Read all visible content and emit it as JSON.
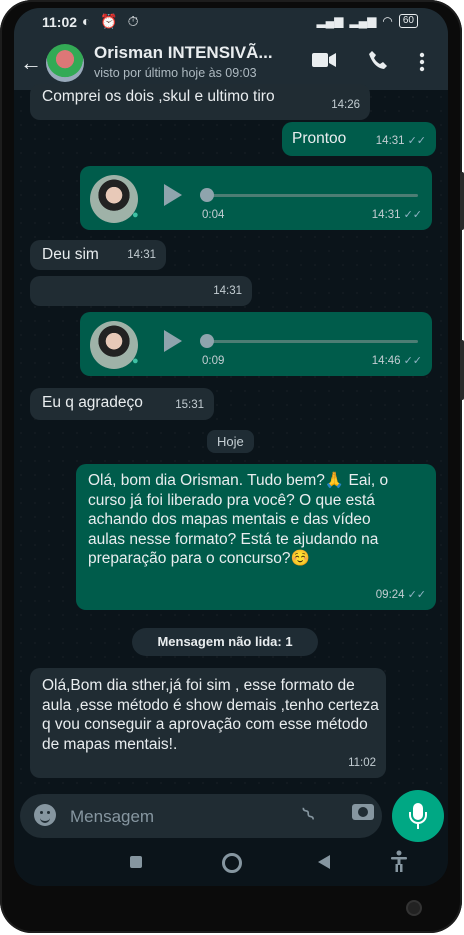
{
  "status_bar": {
    "time": "11:02",
    "left_icons": "◐ ⏰ ⏱",
    "signal": "▂▄▆",
    "wifi": "◠",
    "battery": "60"
  },
  "header": {
    "contact_name": "Orisman INTENSIVÃ...",
    "last_seen": "visto por último hoje às 09:03",
    "back_icon": "←",
    "video_icon": "■",
    "call_icon": "✆",
    "menu_icon": "⋮"
  },
  "messages": [
    {
      "id": "m1",
      "direction": "in",
      "text": "Comprei os dois ,skul e ultimo tiro",
      "time": "14:26"
    },
    {
      "id": "m2",
      "direction": "out",
      "text": "Prontoo",
      "time": "14:31",
      "ticks": "✓✓"
    },
    {
      "id": "m3",
      "direction": "out",
      "type": "voice",
      "duration": "0:04",
      "time": "14:31",
      "ticks": "✓✓"
    },
    {
      "id": "m4",
      "direction": "in",
      "text": "Deu sim",
      "time": "14:31"
    },
    {
      "id": "m5",
      "direction": "in",
      "text": "",
      "time": "14:31"
    },
    {
      "id": "m6",
      "direction": "out",
      "type": "voice",
      "duration": "0:09",
      "time": "14:46",
      "ticks": "✓✓"
    },
    {
      "id": "m7",
      "direction": "in",
      "text": "Eu q agradeço",
      "time": "15:31"
    },
    {
      "id": "m8",
      "direction": "out",
      "text": "Olá, bom dia Orisman. Tudo bem?🙏 Eai, o curso já foi liberado pra você? O que está achando dos mapas mentais e das vídeo aulas nesse formato? Está te ajudando na preparação para o concurso?☺️",
      "time": "09:24",
      "ticks": "✓✓"
    },
    {
      "id": "m9",
      "direction": "in",
      "text": "Olá,Bom dia sther,já foi sim , esse formato de aula ,esse método é show demais ,tenho certeza q vou conseguir a aprovação com esse método de mapas mentais!.",
      "time": "11:02"
    }
  ],
  "date_divider": "Hoje",
  "unread_divider": "Mensagem não lida: 1",
  "composer": {
    "placeholder": "Mensagem",
    "emoji_icon": "emoji-icon",
    "attach_icon": "📎",
    "camera_icon": "camera-icon",
    "mic_icon": "mic-icon"
  },
  "nav": {
    "accessibility_icon": "🯅"
  },
  "colors": {
    "header_bg": "#1f2c34",
    "chat_bg": "#0b141a",
    "incoming": "#202c33",
    "outgoing": "#005c4b",
    "accent": "#00a884"
  }
}
